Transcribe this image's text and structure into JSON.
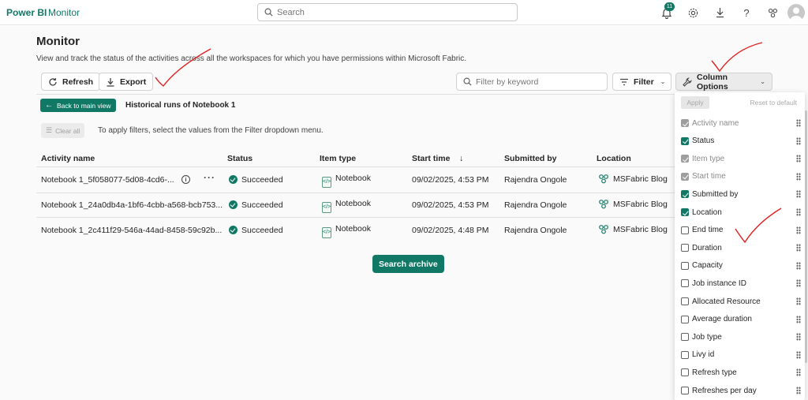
{
  "topbar": {
    "brand": "Power BI",
    "app": "Monitor",
    "search_placeholder": "Search",
    "notification_count": "11"
  },
  "page": {
    "title": "Monitor",
    "subtitle": "View and track the status of the activities across all the workspaces for which you have permissions within Microsoft Fabric."
  },
  "toolbar": {
    "refresh": "Refresh",
    "export": "Export",
    "keyword_placeholder": "Filter by keyword",
    "filter": "Filter",
    "column_options": "Column Options"
  },
  "nav": {
    "back": "Back to main view",
    "historical_title": "Historical runs of Notebook 1",
    "clear_all": "Clear all",
    "hint": "To apply filters, select the values from the Filter dropdown menu."
  },
  "table": {
    "headers": [
      "Activity name",
      "Status",
      "Item type",
      "Start time",
      "Submitted by",
      "Location"
    ],
    "rows": [
      {
        "activity": "Notebook 1_5f058077-5d08-4cd6-...",
        "status": "Succeeded",
        "item_type": "Notebook",
        "start": "09/02/2025, 4:53 PM",
        "submitted_by": "Rajendra Ongole",
        "location": "MSFabric Blog"
      },
      {
        "activity": "Notebook 1_24a0db4a-1bf6-4cbb-a568-bcb753...",
        "status": "Succeeded",
        "item_type": "Notebook",
        "start": "09/02/2025, 4:53 PM",
        "submitted_by": "Rajendra Ongole",
        "location": "MSFabric Blog"
      },
      {
        "activity": "Notebook 1_2c411f29-546a-44ad-8458-59c92b...",
        "status": "Succeeded",
        "item_type": "Notebook",
        "start": "09/02/2025, 4:48 PM",
        "submitted_by": "Rajendra Ongole",
        "location": "MSFabric Blog"
      }
    ]
  },
  "search_archive": "Search archive",
  "column_panel": {
    "apply": "Apply",
    "reset": "Reset to default",
    "options": [
      {
        "label": "Activity name",
        "state": "disabled"
      },
      {
        "label": "Status",
        "state": "checked"
      },
      {
        "label": "Item type",
        "state": "disabled"
      },
      {
        "label": "Start time",
        "state": "disabled"
      },
      {
        "label": "Submitted by",
        "state": "checked"
      },
      {
        "label": "Location",
        "state": "checked"
      },
      {
        "label": "End time",
        "state": "unchecked"
      },
      {
        "label": "Duration",
        "state": "unchecked"
      },
      {
        "label": "Capacity",
        "state": "unchecked"
      },
      {
        "label": "Job instance ID",
        "state": "unchecked"
      },
      {
        "label": "Allocated Resource",
        "state": "unchecked"
      },
      {
        "label": "Average duration",
        "state": "unchecked"
      },
      {
        "label": "Job type",
        "state": "unchecked"
      },
      {
        "label": "Livy id",
        "state": "unchecked"
      },
      {
        "label": "Refresh type",
        "state": "unchecked"
      },
      {
        "label": "Refreshes per day",
        "state": "unchecked"
      }
    ]
  },
  "colors": {
    "accent": "#117865",
    "annotation": "#e02020"
  }
}
